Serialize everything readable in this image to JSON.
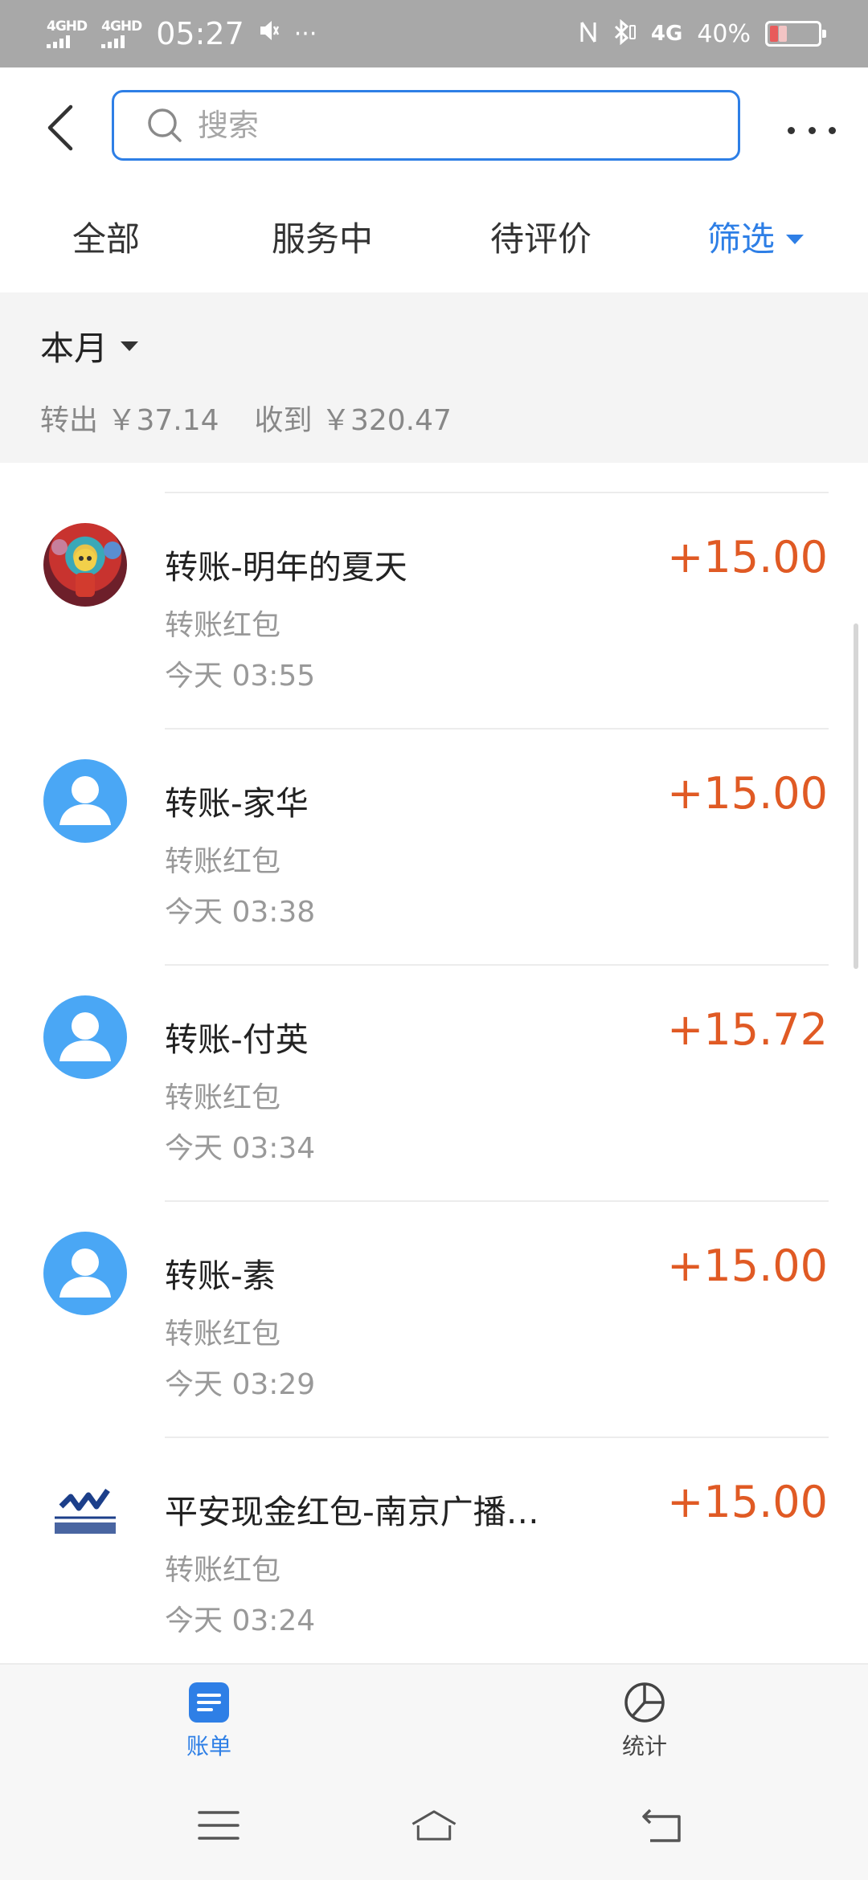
{
  "status_bar": {
    "sim1": "4GHD",
    "sim2": "4GHD",
    "time": "05:27",
    "more": "···",
    "network_4g": "4G",
    "battery_percent": "40%"
  },
  "header": {
    "search_placeholder": "搜索"
  },
  "tabs": [
    {
      "label": "全部"
    },
    {
      "label": "服务中"
    },
    {
      "label": "待评价"
    },
    {
      "label": "筛选"
    }
  ],
  "summary": {
    "month_label": "本月",
    "outgoing": "转出 ￥37.14",
    "incoming": "收到 ￥320.47"
  },
  "transactions": [
    {
      "title": "转账-明年的夏天",
      "subtitle": "转账红包",
      "time": "今天  03:55",
      "amount": "+15.00",
      "avatar": "photo"
    },
    {
      "title": "转账-家华",
      "subtitle": "转账红包",
      "time": "今天  03:38",
      "amount": "+15.00",
      "avatar": "default-user"
    },
    {
      "title": "转账-付英",
      "subtitle": "转账红包",
      "time": "今天  03:34",
      "amount": "+15.72",
      "avatar": "default-user"
    },
    {
      "title": "转账-素",
      "subtitle": "转账红包",
      "time": "今天  03:29",
      "amount": "+15.00",
      "avatar": "default-user"
    },
    {
      "title": "平安现金红包-南京广播…",
      "subtitle": "转账红包",
      "time": "今天  03:24",
      "amount": "+15.00",
      "avatar": "logo"
    }
  ],
  "bottom_tabs": [
    {
      "label": "账单",
      "icon": "bill-icon",
      "active": true
    },
    {
      "label": "统计",
      "icon": "pie-chart-icon",
      "active": false
    }
  ],
  "colors": {
    "accent": "#2e7fe6",
    "amount": "#e05a24",
    "avatar_default": "#4aa7f5"
  }
}
